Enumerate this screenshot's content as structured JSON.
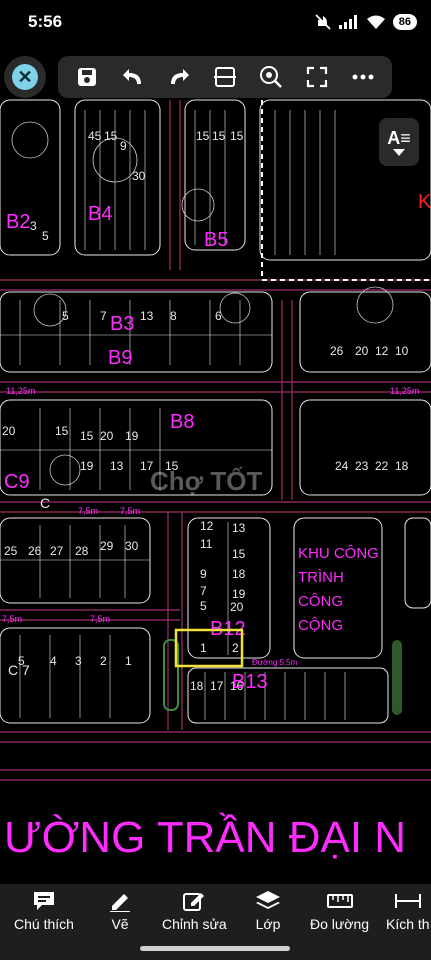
{
  "status": {
    "time": "5:56",
    "battery": "86"
  },
  "toolbar": {
    "close_icon": "close-icon",
    "tools": [
      "save-icon",
      "undo-icon",
      "redo-icon",
      "compare-icon",
      "zoom-icon",
      "fit-screen-icon",
      "more-icon"
    ]
  },
  "view_button": {
    "label": "A≡"
  },
  "map": {
    "blocks": [
      "B2",
      "B4",
      "B5",
      "B3",
      "B9",
      "B8",
      "C9",
      "B12",
      "B13"
    ],
    "labels": {
      "b2": "B2",
      "b4": "B4",
      "b5": "B5",
      "b3": "B3",
      "b9": "B9",
      "b8": "B8",
      "c9": "C9",
      "b12": "B12",
      "b13": "B13",
      "c": "C",
      "c7": "C 7",
      "k": "K"
    },
    "street_widths": [
      "11,25m",
      "11,25m",
      "7,5m",
      "7,5m",
      "7,5m",
      "7,5m"
    ],
    "public_area": [
      "KHU CÔNG",
      "TRÌNH",
      "CÔNG",
      "CỘNG"
    ],
    "road_text": "ƯỜNG TRẦN ĐẠI N",
    "road_small": "Đường 5,5m",
    "watermark": "Chợ TỐT"
  },
  "bottom_nav": [
    {
      "label": "Chú thích",
      "icon": "comment-icon"
    },
    {
      "label": "Vẽ",
      "icon": "pen-icon"
    },
    {
      "label": "Chỉnh sửa",
      "icon": "edit-icon"
    },
    {
      "label": "Lớp",
      "icon": "layers-icon"
    },
    {
      "label": "Đo lường",
      "icon": "ruler-icon"
    },
    {
      "label": "Kích th",
      "icon": "dimension-icon"
    }
  ],
  "colors": {
    "magenta": "#ff2cff",
    "road_line": "#a0306a",
    "lot_line": "#e8e8e8",
    "highlight": "#f2e23a",
    "toolbar_bg": "#2a2a2a",
    "close_accent": "#7fd1e6"
  }
}
